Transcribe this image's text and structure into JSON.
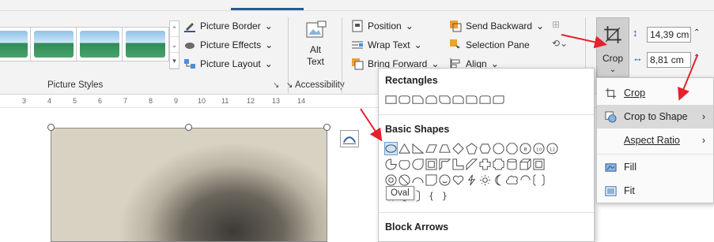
{
  "ribbon": {
    "picture_styles": {
      "label": "Picture Styles",
      "border": "Picture Border",
      "effects": "Picture Effects",
      "layout": "Picture Layout"
    },
    "accessibility": {
      "label": "Accessibility",
      "alt_text_line1": "Alt",
      "alt_text_line2": "Text"
    },
    "arrange": {
      "position": "Position",
      "wrap_text": "Wrap Text",
      "bring_forward": "Bring Forward",
      "send_backward": "Send Backward",
      "selection_pane": "Selection Pane",
      "align": "Align"
    },
    "size": {
      "crop": "Crop",
      "height": "14,39 cm",
      "width": "8,81 cm"
    }
  },
  "ruler": {
    "ticks": [
      "3",
      "4",
      "5",
      "6",
      "7",
      "8",
      "9",
      "10",
      "11",
      "12",
      "13",
      "14"
    ]
  },
  "shapes_menu": {
    "rectangles": "Rectangles",
    "basic_shapes": "Basic Shapes",
    "block_arrows": "Block Arrows",
    "tooltip": "Oval"
  },
  "crop_menu": {
    "items": [
      {
        "label": "Crop",
        "icon": "crop-icon"
      },
      {
        "label": "Crop to Shape",
        "icon": "crop-shape-icon"
      },
      {
        "label": "Aspect Ratio",
        "icon": ""
      },
      {
        "label": "Fill",
        "icon": "fill-icon"
      },
      {
        "label": "Fit",
        "icon": "fit-icon"
      }
    ]
  },
  "colors": {
    "accent": "#2b579a",
    "annotation_arrow": "#e3222b",
    "hover": "#d9d9d9"
  }
}
